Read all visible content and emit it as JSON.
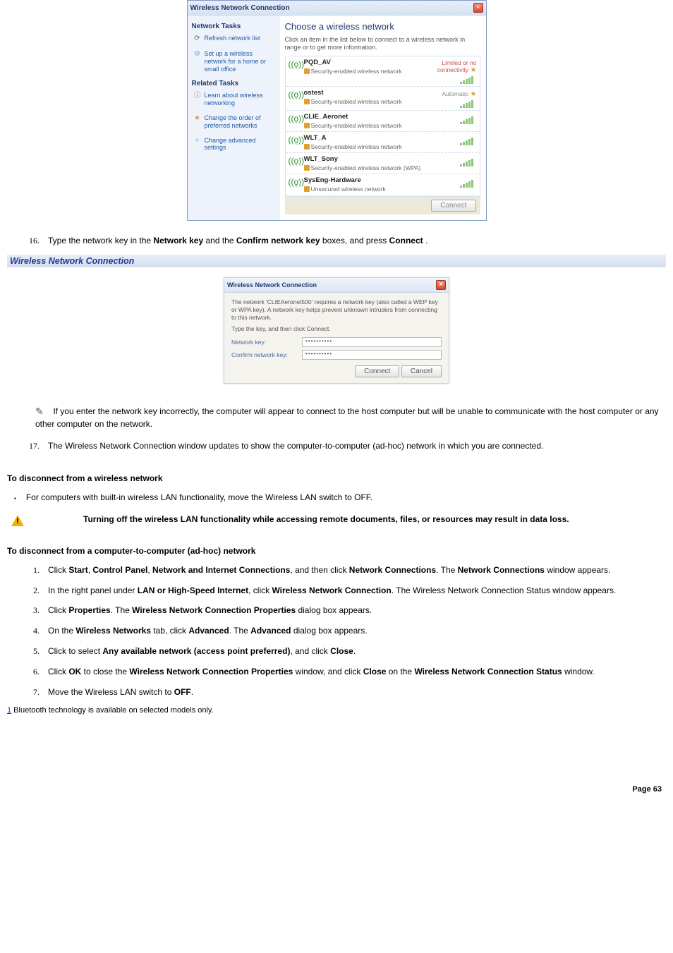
{
  "xp_dialog": {
    "title": "Wireless Network Connection",
    "side": {
      "tasks_header": "Network Tasks",
      "refresh": "Refresh network list",
      "setup": "Set up a wireless network for a home or small office",
      "related_header": "Related Tasks",
      "learn": "Learn about wireless networking",
      "order": "Change the order of preferred networks",
      "advanced": "Change advanced settings"
    },
    "main_header": "Choose a wireless network",
    "main_desc": "Click an item in the list below to connect to a wireless network in range or to get more information.",
    "networks": [
      {
        "name": "PQD_AV",
        "sec": "Security-enabled wireless network",
        "status": "Limited or no connectivity",
        "star": true
      },
      {
        "name": "ostest",
        "sec": "Security-enabled wireless network",
        "status": "Automatic",
        "star": true
      },
      {
        "name": "CLIE_Aeronet",
        "sec": "Security-enabled wireless network",
        "status": "",
        "star": false
      },
      {
        "name": "WLT_A",
        "sec": "Security-enabled wireless network",
        "status": "",
        "star": false
      },
      {
        "name": "WLT_Sony",
        "sec": "Security-enabled wireless network (WPA)",
        "status": "",
        "star": false
      },
      {
        "name": "SysEng-Hardware",
        "sec": "Unsecured wireless network",
        "status": "",
        "star": false
      }
    ],
    "connect_btn": "Connect"
  },
  "step16_num": "16.",
  "step16_a": "Type the network key in the ",
  "step16_b": "Network key",
  "step16_c": " and the ",
  "step16_d": "Confirm network key",
  "step16_e": " boxes, and press ",
  "step16_f": "Connect",
  "step16_g": ".",
  "subtitle": "Wireless Network Connection",
  "key_dialog": {
    "title": "Wireless Network Connection",
    "desc1": "The network 'CLIEAeronet500' requires a network key (also called a WEP key or WPA key). A network key helps prevent unknown intruders from connecting to this network.",
    "desc2": "Type the key, and then click Connect.",
    "label1": "Network key:",
    "value1": "••••••••••",
    "label2": "Confirm network key:",
    "value2": "••••••••••",
    "btn_connect": "Connect",
    "btn_cancel": "Cancel"
  },
  "note_text": "If you enter the network key incorrectly, the computer will appear to connect to the host computer but will be unable to communicate with the host computer or any other computer on the network.",
  "step17_num": "17.",
  "step17_txt": "The Wireless Network Connection window updates to show the computer-to-computer (ad-hoc) network in which you are connected.",
  "disc1_head": "To disconnect from a wireless network",
  "disc1_bullet": "For computers with built-in wireless LAN functionality, move the Wireless LAN switch to OFF.",
  "warn_text": "Turning off the wireless LAN functionality while accessing remote documents, files, or resources may result in data loss.",
  "disc2_head": "To disconnect from a computer-to-computer (ad-hoc) network",
  "adhoc_steps": {
    "s1a": "Click ",
    "s1b": "Start",
    "s1c": ", ",
    "s1d": "Control Panel",
    "s1e": ", ",
    "s1f": "Network and Internet Connections",
    "s1g": ", and then click ",
    "s1h": "Network Connections",
    "s1i": ". The ",
    "s1j": "Network Connections",
    "s1k": " window appears.",
    "s2a": "In the right panel under ",
    "s2b": "LAN or High-Speed Internet",
    "s2c": ", click ",
    "s2d": "Wireless Network Connection",
    "s2e": ". The Wireless Network Connection Status window appears.",
    "s3a": "Click ",
    "s3b": "Properties",
    "s3c": ". The ",
    "s3d": "Wireless Network Connection Properties",
    "s3e": " dialog box appears.",
    "s4a": "On the ",
    "s4b": "Wireless Networks",
    "s4c": " tab, click ",
    "s4d": "Advanced",
    "s4e": ". The ",
    "s4f": "Advanced",
    "s4g": " dialog box appears.",
    "s5a": "Click to select ",
    "s5b": "Any available network (access point preferred)",
    "s5c": ", and click ",
    "s5d": "Close",
    "s5e": ".",
    "s6a": "Click ",
    "s6b": "OK",
    "s6c": " to close the ",
    "s6d": "Wireless Network Connection Properties",
    "s6e": " window, and click ",
    "s6f": "Close",
    "s6g": " on the ",
    "s6h": "Wireless Network Connection Status",
    "s6i": " window.",
    "s7a": "Move the Wireless LAN switch to ",
    "s7b": "OFF",
    "s7c": "."
  },
  "footnote_anchor": "1",
  "footnote": " Bluetooth technology is available on selected models only.",
  "page_num": "Page 63"
}
